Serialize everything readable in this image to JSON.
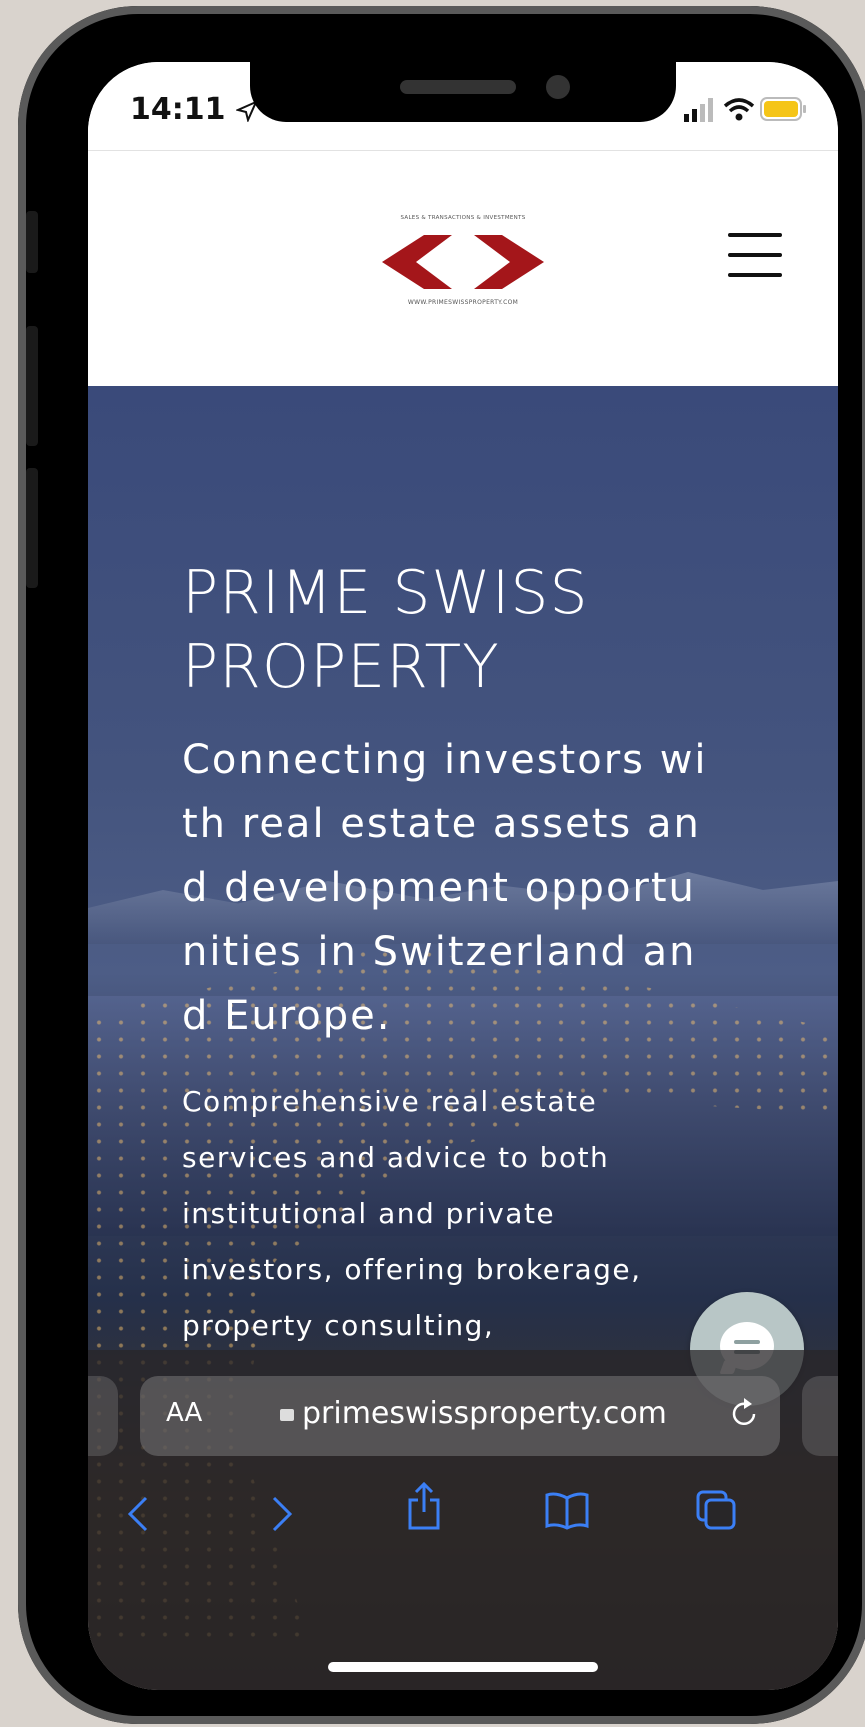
{
  "status_bar": {
    "time": "14:11",
    "battery_color": "#f5c518"
  },
  "header": {
    "logo_top_text": "SALES & TRANSACTIONS & INVESTMENTS",
    "logo_bottom_text": "WWW.PRIMESWISSPROPERTY.COM",
    "brand_color": "#a4161a"
  },
  "hero": {
    "title": "PRIME SWISS PROPERTY",
    "subtitle": "Connecting investors with real estate assets and development opportunities in Switzerland and Europe.",
    "body": "Comprehensive real estate services and advice to both institutional and private investors, offering brokerage, property consulting,"
  },
  "browser": {
    "text_size_label": "AA",
    "url": "primeswissproperty.com",
    "accent_color": "#3b7ff5"
  },
  "icons": {
    "menu": "hamburger-menu-icon",
    "chat": "chat-bubble-icon",
    "back": "chevron-left-icon",
    "forward": "chevron-right-icon",
    "share": "share-icon",
    "bookmarks": "book-icon",
    "tabs": "tabs-icon",
    "reload": "reload-icon",
    "lock": "lock-icon"
  }
}
